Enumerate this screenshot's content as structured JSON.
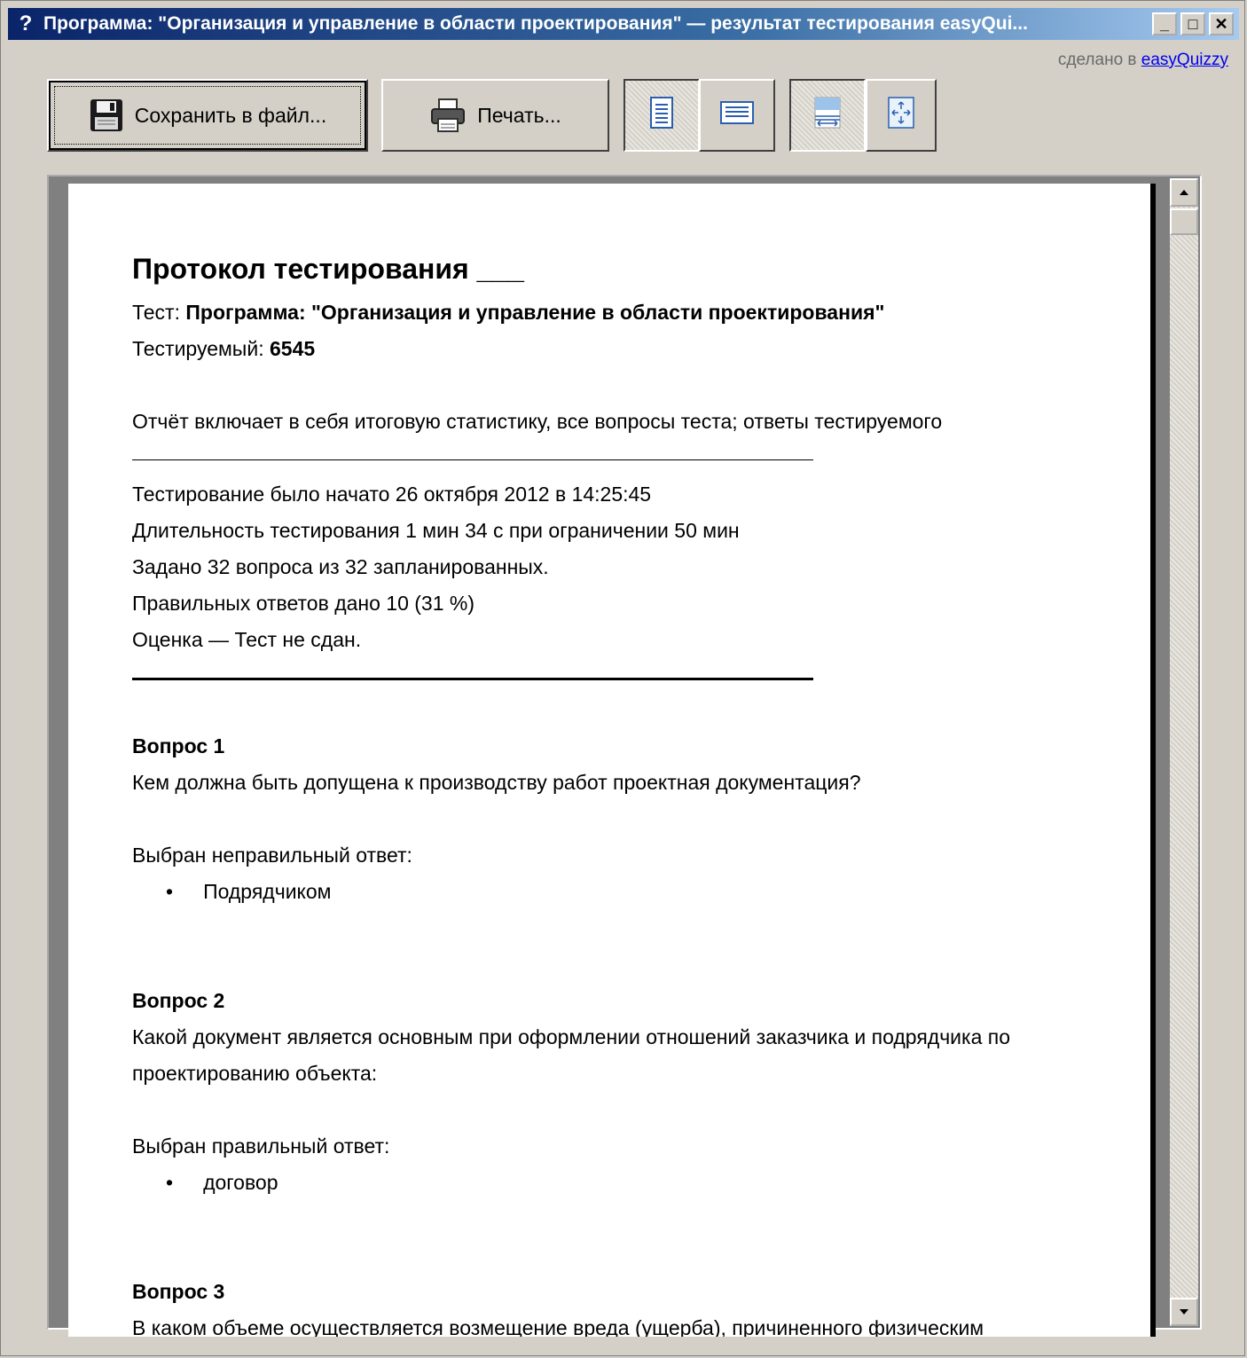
{
  "window": {
    "title": "Программа: \"Организация и управление в области проектирования\" — результат тестирования easyQui...",
    "title_icon": "?",
    "minimize": "_",
    "maximize": "□",
    "close": "✕"
  },
  "madeby": {
    "prefix": "сделано в",
    "link": "easyQuizzy"
  },
  "toolbar": {
    "save_label": "Сохранить в файл...",
    "print_label": "Печать...",
    "icons": [
      "save-icon",
      "printer-icon",
      "page-portrait-icon",
      "page-landscape-icon",
      "fit-width-icon",
      "fit-page-icon"
    ]
  },
  "report": {
    "heading": "Протокол тестирования ___",
    "test_prefix": "Тест: ",
    "test_name": "Программа: \"Организация и управление в области проектирования\"",
    "testee_prefix": "Тестируемый: ",
    "testee": "6545",
    "description": "Отчёт включает в себя итоговую статистику, все вопросы теста; ответы тестируемого",
    "stats": [
      "Тестирование было начато 26 октября 2012 в 14:25:45",
      "Длительность тестирования 1 мин 34 с при ограничении 50 мин",
      "Задано 32 вопроса из 32 запланированных.",
      "Правильных ответов дано 10 (31 %)",
      "Оценка — Тест не сдан."
    ],
    "questions": [
      {
        "title": "Вопрос 1",
        "text": "Кем должна быть допущена к производству работ проектная документация?",
        "result": "Выбран неправильный ответ:",
        "answer": "Подрядчиком"
      },
      {
        "title": "Вопрос 2",
        "text": "Какой документ является основным при оформлении отношений заказчика и подрядчика по проектированию объекта:",
        "result": "Выбран правильный ответ:",
        "answer": "договор"
      },
      {
        "title": "Вопрос 3",
        "text": "В каком объеме осуществляется возмещение вреда (ущерба), причиненного физическим"
      }
    ],
    "bullet": "•"
  }
}
